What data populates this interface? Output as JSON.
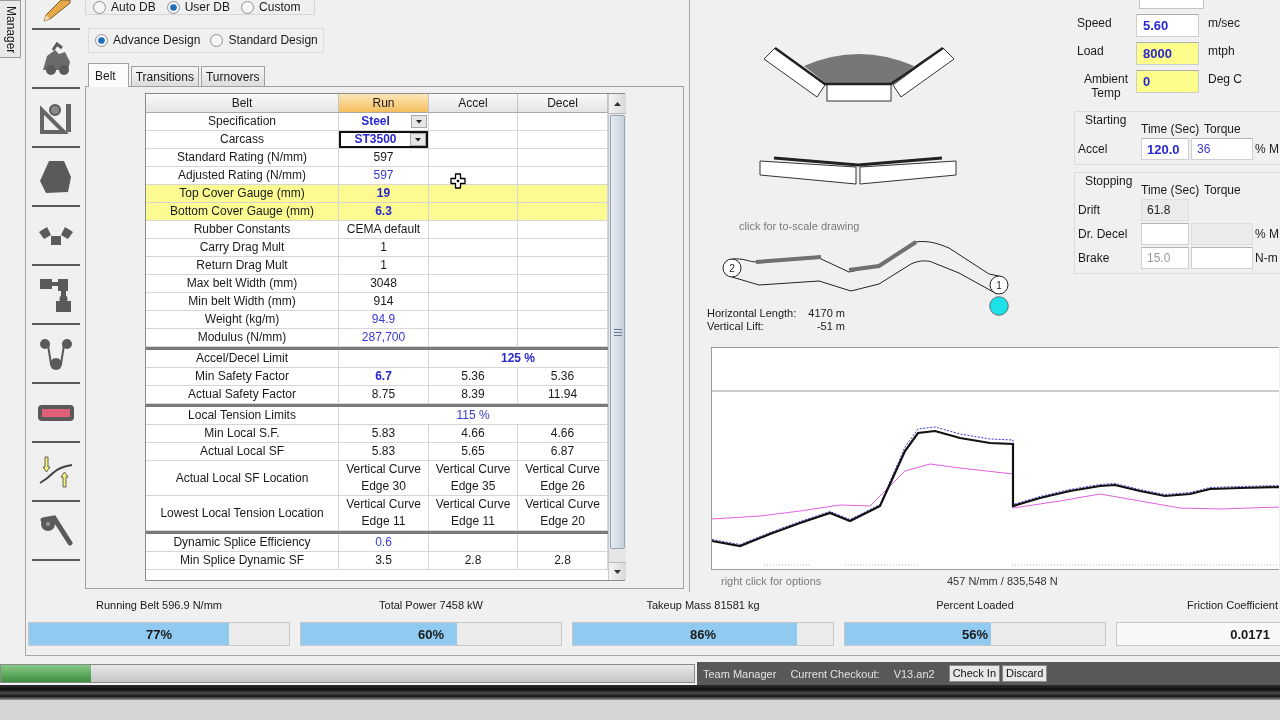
{
  "side_tab": {
    "label": "Manager"
  },
  "database_options": [
    {
      "label": "Auto DB",
      "selected": false
    },
    {
      "label": "User DB",
      "selected": true
    },
    {
      "label": "Custom",
      "selected": false
    }
  ],
  "design_modes": [
    {
      "label": "Advance Design",
      "selected": true
    },
    {
      "label": "Standard Design",
      "selected": false
    }
  ],
  "tabs": [
    {
      "label": "Belt",
      "selected": true
    },
    {
      "label": "Transitions",
      "selected": false
    },
    {
      "label": "Turnovers",
      "selected": false
    }
  ],
  "table": {
    "columns": [
      {
        "label": "Belt",
        "selected": false
      },
      {
        "label": "Run",
        "selected": true
      },
      {
        "label": "Accel",
        "selected": false
      },
      {
        "label": "Decel",
        "selected": false
      }
    ],
    "sections": [
      {
        "rows": [
          {
            "label": "Specification",
            "highlighted": false,
            "cells": [
              {
                "text": "Steel",
                "kind": "dropdown",
                "focused": false
              }
            ]
          },
          {
            "label": "Carcass",
            "highlighted": false,
            "cells": [
              {
                "text": "ST3500",
                "kind": "dropdown",
                "focused": true
              }
            ]
          },
          {
            "label": "Standard Rating (N/mm)",
            "highlighted": false,
            "cells": [
              {
                "text": "597",
                "kind": "plain"
              }
            ]
          },
          {
            "label": "Adjusted Rating (N/mm)",
            "highlighted": false,
            "cells": [
              {
                "text": "597",
                "kind": "derived"
              }
            ]
          },
          {
            "label": "Top Cover Gauge (mm)",
            "highlighted": true,
            "cells": [
              {
                "text": "19",
                "kind": "entry"
              }
            ]
          },
          {
            "label": "Bottom Cover Gauge (mm)",
            "highlighted": true,
            "cells": [
              {
                "text": "6.3",
                "kind": "entry"
              }
            ]
          },
          {
            "label": "Rubber Constants",
            "highlighted": false,
            "cells": [
              {
                "text": "CEMA default",
                "kind": "plain"
              }
            ]
          },
          {
            "label": "Carry Drag Mult",
            "highlighted": false,
            "cells": [
              {
                "text": "1",
                "kind": "plain"
              }
            ]
          },
          {
            "label": "Return Drag Mult",
            "highlighted": false,
            "cells": [
              {
                "text": "1",
                "kind": "plain"
              }
            ]
          },
          {
            "label": "Max belt Width (mm)",
            "highlighted": false,
            "cells": [
              {
                "text": "3048",
                "kind": "plain"
              }
            ]
          },
          {
            "label": "Min belt Width (mm)",
            "highlighted": false,
            "cells": [
              {
                "text": "914",
                "kind": "plain"
              }
            ]
          },
          {
            "label": "Weight (kg/m)",
            "highlighted": false,
            "cells": [
              {
                "text": "94.9",
                "kind": "derived"
              }
            ]
          },
          {
            "label": "Modulus (N/mm)",
            "highlighted": false,
            "cells": [
              {
                "text": "287,700",
                "kind": "derived"
              }
            ]
          }
        ]
      },
      {
        "rows": [
          {
            "label": "Accel/Decel Limit",
            "highlighted": false,
            "cells": [
              "",
              {
                "text": "125 %",
                "kind": "entry"
              },
              {
                "kind": "merged"
              }
            ]
          },
          {
            "label": "Min Safety Factor",
            "highlighted": false,
            "cells": [
              {
                "text": "6.7",
                "kind": "entry"
              },
              {
                "text": "5.36",
                "kind": "plain"
              },
              {
                "text": "5.36",
                "kind": "plain"
              }
            ]
          },
          {
            "label": "Actual Safety Factor",
            "highlighted": false,
            "cells": [
              {
                "text": "8.75",
                "kind": "plain"
              },
              {
                "text": "8.39",
                "kind": "plain"
              },
              {
                "text": "11.94",
                "kind": "plain"
              }
            ]
          }
        ]
      },
      {
        "rows": [
          {
            "label": "Local Tension Limits",
            "highlighted": false,
            "cells": [
              {
                "kind": "merged"
              },
              {
                "text": "115 %",
                "kind": "derived"
              },
              {
                "kind": "merged"
              }
            ]
          },
          {
            "label": "Min Local S.F.",
            "highlighted": false,
            "cells": [
              {
                "text": "5.83",
                "kind": "plain"
              },
              {
                "text": "4.66",
                "kind": "plain"
              },
              {
                "text": "4.66",
                "kind": "plain"
              }
            ]
          },
          {
            "label": "Actual Local SF",
            "highlighted": false,
            "cells": [
              {
                "text": "5.83",
                "kind": "plain"
              },
              {
                "text": "5.65",
                "kind": "plain"
              },
              {
                "text": "6.87",
                "kind": "plain"
              }
            ]
          },
          {
            "label": "Actual Local SF Location",
            "highlighted": false,
            "cells": [
              {
                "text": "Vertical Curve Edge 30",
                "kind": "plain"
              },
              {
                "text": "Vertical Curve Edge 35",
                "kind": "plain"
              },
              {
                "text": "Vertical Curve Edge 26",
                "kind": "plain"
              }
            ]
          },
          {
            "label": "Lowest Local Tension Location",
            "highlighted": false,
            "cells": [
              {
                "text": "Vertical Curve Edge 11",
                "kind": "plain"
              },
              {
                "text": "Vertical Curve Edge 11",
                "kind": "plain"
              },
              {
                "text": "Vertical Curve Edge 20",
                "kind": "plain"
              }
            ]
          }
        ]
      },
      {
        "rows": [
          {
            "label": "Dynamic Splice Efficiency",
            "highlighted": false,
            "cells": [
              {
                "text": "0.6",
                "kind": "derived"
              }
            ]
          },
          {
            "label": "Min Splice Dynamic SF",
            "highlighted": false,
            "cells": [
              {
                "text": "3.5",
                "kind": "plain"
              },
              {
                "text": "2.8",
                "kind": "plain"
              },
              {
                "text": "2.8",
                "kind": "plain"
              }
            ]
          }
        ]
      }
    ]
  },
  "profile": {
    "hint": "click for to-scale drawing",
    "nodes": [
      {
        "label": "2"
      },
      {
        "label": "1"
      }
    ],
    "measurements": [
      {
        "label": "Horizontal Length:",
        "value": "4170 m"
      },
      {
        "label": "Vertical Lift:",
        "value": "-51 m"
      }
    ]
  },
  "parameters": [
    {
      "label": "Speed",
      "value": "5.60",
      "unit": "m/sec",
      "highlighted": false
    },
    {
      "label": "Load",
      "value": "8000",
      "unit": "mtph",
      "highlighted": true
    },
    {
      "label": "Ambient Temp",
      "value": "0",
      "unit": "Deg C",
      "highlighted": true
    }
  ],
  "starting": {
    "title": "Starting",
    "headers": [
      "Time (Sec)",
      "Torque"
    ],
    "rows": [
      {
        "label": "Accel",
        "fields": [
          {
            "value": "120.0",
            "kind": "entry"
          },
          {
            "value": "36",
            "kind": "derived"
          }
        ],
        "unit": "% M"
      }
    ]
  },
  "stopping": {
    "title": "Stopping",
    "headers": [
      "Time (Sec)",
      "Torque"
    ],
    "rows": [
      {
        "label": "Drift",
        "fields": [
          {
            "value": "61.8",
            "kind": "readonly"
          }
        ]
      },
      {
        "label": "Dr. Decel",
        "fields": [
          {
            "kind": "blank"
          },
          {
            "kind": "readonly"
          }
        ],
        "unit": "% M"
      },
      {
        "label": "Brake",
        "fields": [
          {
            "placeholder": "15.0",
            "kind": "blank"
          },
          {
            "kind": "blank"
          }
        ],
        "unit": "N-m"
      }
    ]
  },
  "chart": {
    "hint": "right click for options",
    "readout": "457 N/mm / 835,548 N"
  },
  "status": [
    {
      "kind": "meter",
      "label": "Running Belt 596.9 N/mm",
      "reading": "77%",
      "level": 0.77
    },
    {
      "kind": "meter",
      "label": "Total Power 7458 kW",
      "reading": "60%",
      "level": 0.6
    },
    {
      "kind": "meter",
      "label": "Takeup Mass 81581 kg",
      "reading": "86%",
      "level": 0.86
    },
    {
      "kind": "meter",
      "label": "Percent Loaded",
      "reading": "56%",
      "level": 0.56
    },
    {
      "kind": "readout",
      "label": "Friction Coefficient",
      "reading": "0.0171"
    }
  ],
  "taskbar": {
    "progress": {
      "level": 0.13
    },
    "items": [
      "Team Manager",
      "Current Checkout:",
      "V13.an2"
    ],
    "buttons": [
      "Check In",
      "Discard"
    ]
  }
}
